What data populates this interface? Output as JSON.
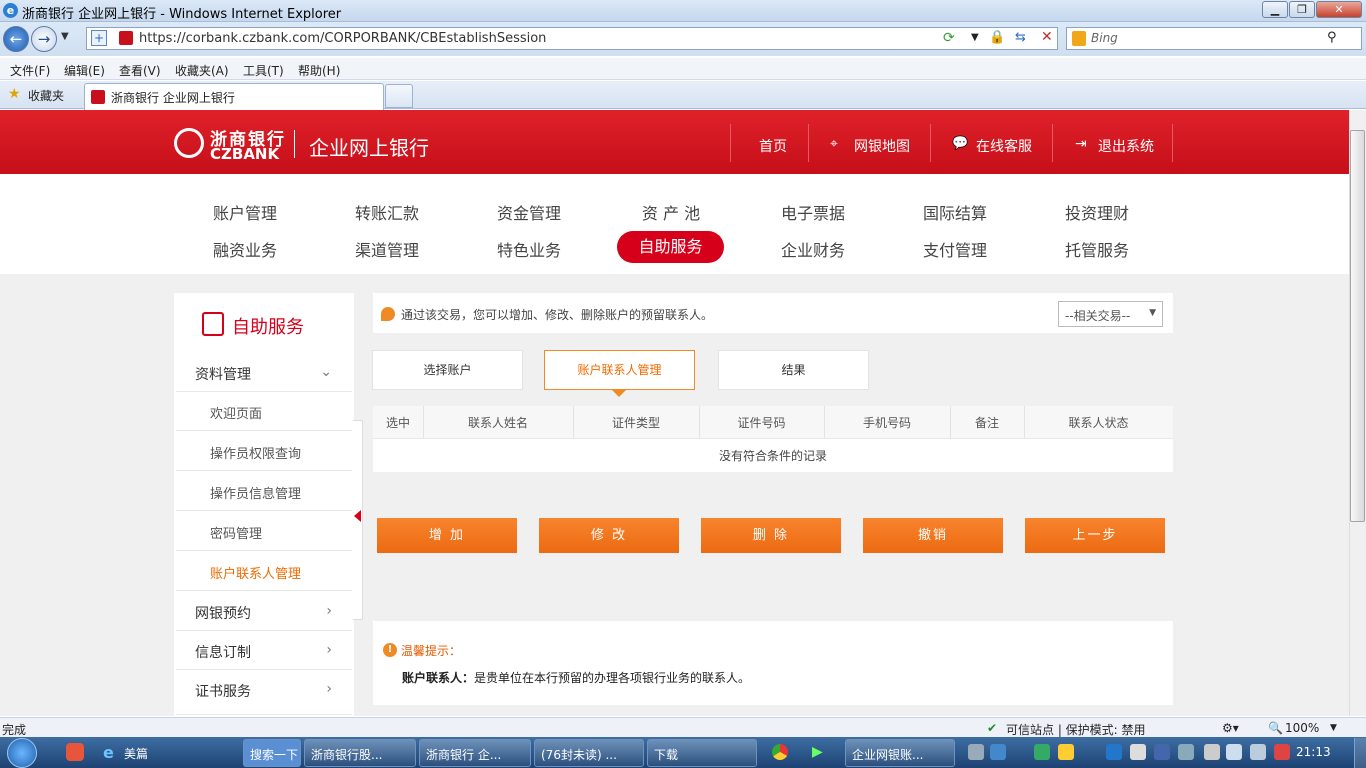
{
  "window": {
    "title": "浙商银行 企业网上银行 - Windows Internet Explorer"
  },
  "address": {
    "url": "https://corbank.czbank.com/CORPORBANK/CBEstablishSession",
    "search_placeholder": "Bing"
  },
  "menu": [
    "文件(F)",
    "编辑(E)",
    "查看(V)",
    "收藏夹(A)",
    "工具(T)",
    "帮助(H)"
  ],
  "favorites": {
    "label": "收藏夹",
    "tab_title": "浙商银行 企业网上银行"
  },
  "header": {
    "logo_cn": "浙商银行",
    "logo_en": "CZBANK",
    "site_name": "企业网上银行",
    "links": [
      "首页",
      "网银地图",
      "在线客服",
      "退出系统"
    ]
  },
  "nav": {
    "row1": [
      "账户管理",
      "转账汇款",
      "资金管理",
      "资 产 池",
      "电子票据",
      "国际结算",
      "投资理财"
    ],
    "row2": [
      "融资业务",
      "渠道管理",
      "特色业务",
      "自助服务",
      "企业财务",
      "支付管理",
      "托管服务"
    ],
    "active": "自助服务"
  },
  "sidebar": {
    "title": "自助服务",
    "group1": "资料管理",
    "subitems": [
      "欢迎页面",
      "操作员权限查询",
      "操作员信息管理",
      "密码管理",
      "账户联系人管理"
    ],
    "active_sub": "账户联系人管理",
    "groups": [
      "网银预约",
      "信息订制",
      "证书服务"
    ]
  },
  "info": {
    "text": "通过该交易，您可以增加、修改、删除账户的预留联系人。",
    "related_select": "--相关交易--"
  },
  "steps": [
    "选择账户",
    "账户联系人管理",
    "结果"
  ],
  "table": {
    "headers": [
      "选中",
      "联系人姓名",
      "证件类型",
      "证件号码",
      "手机号码",
      "备注",
      "联系人状态"
    ],
    "empty": "没有符合条件的记录"
  },
  "buttons": [
    "增 加",
    "修 改",
    "删 除",
    "撤销",
    "上一步"
  ],
  "tips": {
    "title": "温馨提示：",
    "term": "账户联系人：",
    "body": "是贵单位在本行预留的办理各项银行业务的联系人。"
  },
  "status": {
    "left": "完成",
    "trusted": "可信站点 | 保护模式: 禁用",
    "zoom": "100%"
  },
  "taskbar": {
    "items": [
      "美篇",
      "搜索一下",
      "浙商银行股...",
      "浙商银行 企...",
      "(76封未读) ...",
      "下载",
      "企业网银账..."
    ],
    "clock": "21:13"
  },
  "colors": {
    "brand_red": "#d7001a",
    "orange": "#f07a1c"
  }
}
